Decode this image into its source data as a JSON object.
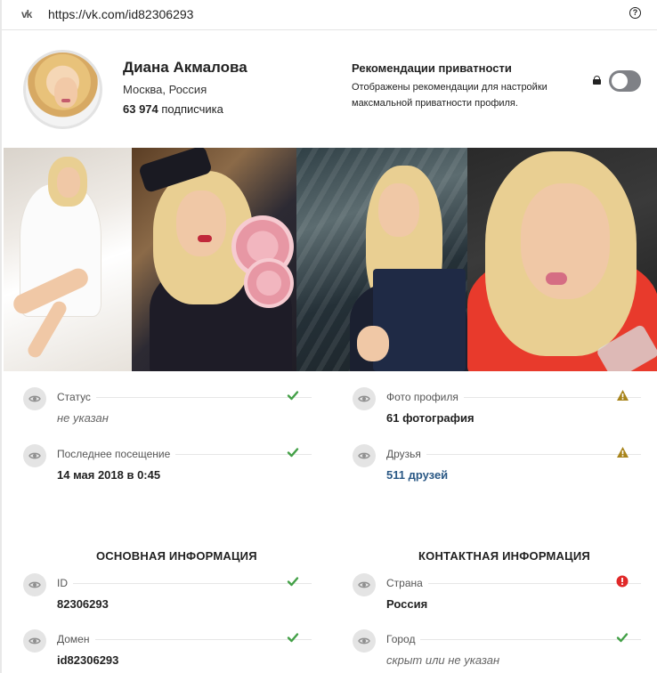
{
  "browser": {
    "url": "https://vk.com/id82306293",
    "logo": "vk-logo",
    "logo_text": "vk"
  },
  "profile": {
    "name": "Диана Акмалова",
    "city": "Москва, Россия",
    "subscribers_count": "63 974",
    "subscribers_label": "подписчика"
  },
  "privacy": {
    "title": "Рекомендации приватности",
    "description": "Отображены рекомендации для настройки максмальной приватности профиля.",
    "toggle_on": false
  },
  "details_left": [
    {
      "label": "Статус",
      "value": "не указан",
      "state": "ok",
      "style": "muted"
    },
    {
      "label": "Последнее посещение",
      "value": "14 мая 2018 в 0:45",
      "state": "ok",
      "style": "bold"
    }
  ],
  "details_right": [
    {
      "label": "Фото профиля",
      "value": "61 фотография",
      "state": "warn",
      "style": "bold"
    },
    {
      "label": "Друзья",
      "value": "511 друзей",
      "state": "warn",
      "style": "link"
    }
  ],
  "sections": {
    "basic_title": "ОСНОВНАЯ ИНФОРМАЦИЯ",
    "contact_title": "КОНТАКТНАЯ ИНФОРМАЦИЯ"
  },
  "basic_info": [
    {
      "label": "ID",
      "value": "82306293",
      "state": "ok",
      "style": "bold"
    },
    {
      "label": "Домен",
      "value": "id82306293",
      "state": "ok",
      "style": "bold"
    }
  ],
  "contact_info": [
    {
      "label": "Страна",
      "value": "Россия",
      "state": "error",
      "style": "bold"
    },
    {
      "label": "Город",
      "value": "скрыт или не указан",
      "state": "ok",
      "style": "muted"
    }
  ],
  "colors": {
    "ok": "#43a047",
    "warn": "#a8841b",
    "error": "#e02828",
    "link": "#2a5885",
    "toggle_off": "#7f8186"
  },
  "icons": {
    "row_icon": "eye-icon",
    "ok_icon": "check-icon",
    "warn_icon": "warning-icon",
    "error_icon": "error-icon",
    "help_icon": "help-icon",
    "lock_icon": "lock-icon"
  }
}
